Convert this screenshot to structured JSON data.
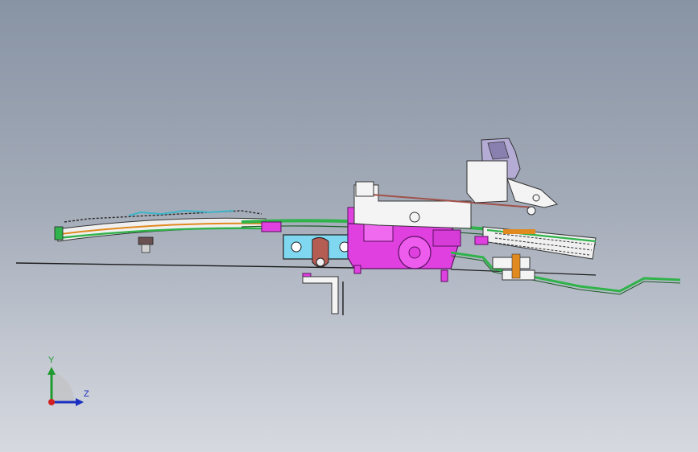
{
  "viewport": {
    "background_top": "#8893a4",
    "background_bottom": "#d6d9df"
  },
  "model": {
    "description_icon": "cad-assembly-icon",
    "colors": {
      "magenta": "#e040e0",
      "cyan": "#7fd7f0",
      "green": "#2fb34a",
      "orange": "#e08a20",
      "rust": "#a0524a",
      "white": "#f2f2f2",
      "dark": "#2a2a2a"
    }
  },
  "triad": {
    "y_label": "Y",
    "z_label": "Z",
    "y_color": "#1f9a2f",
    "z_color": "#1a2fbf",
    "origin_color": "#d22020"
  }
}
